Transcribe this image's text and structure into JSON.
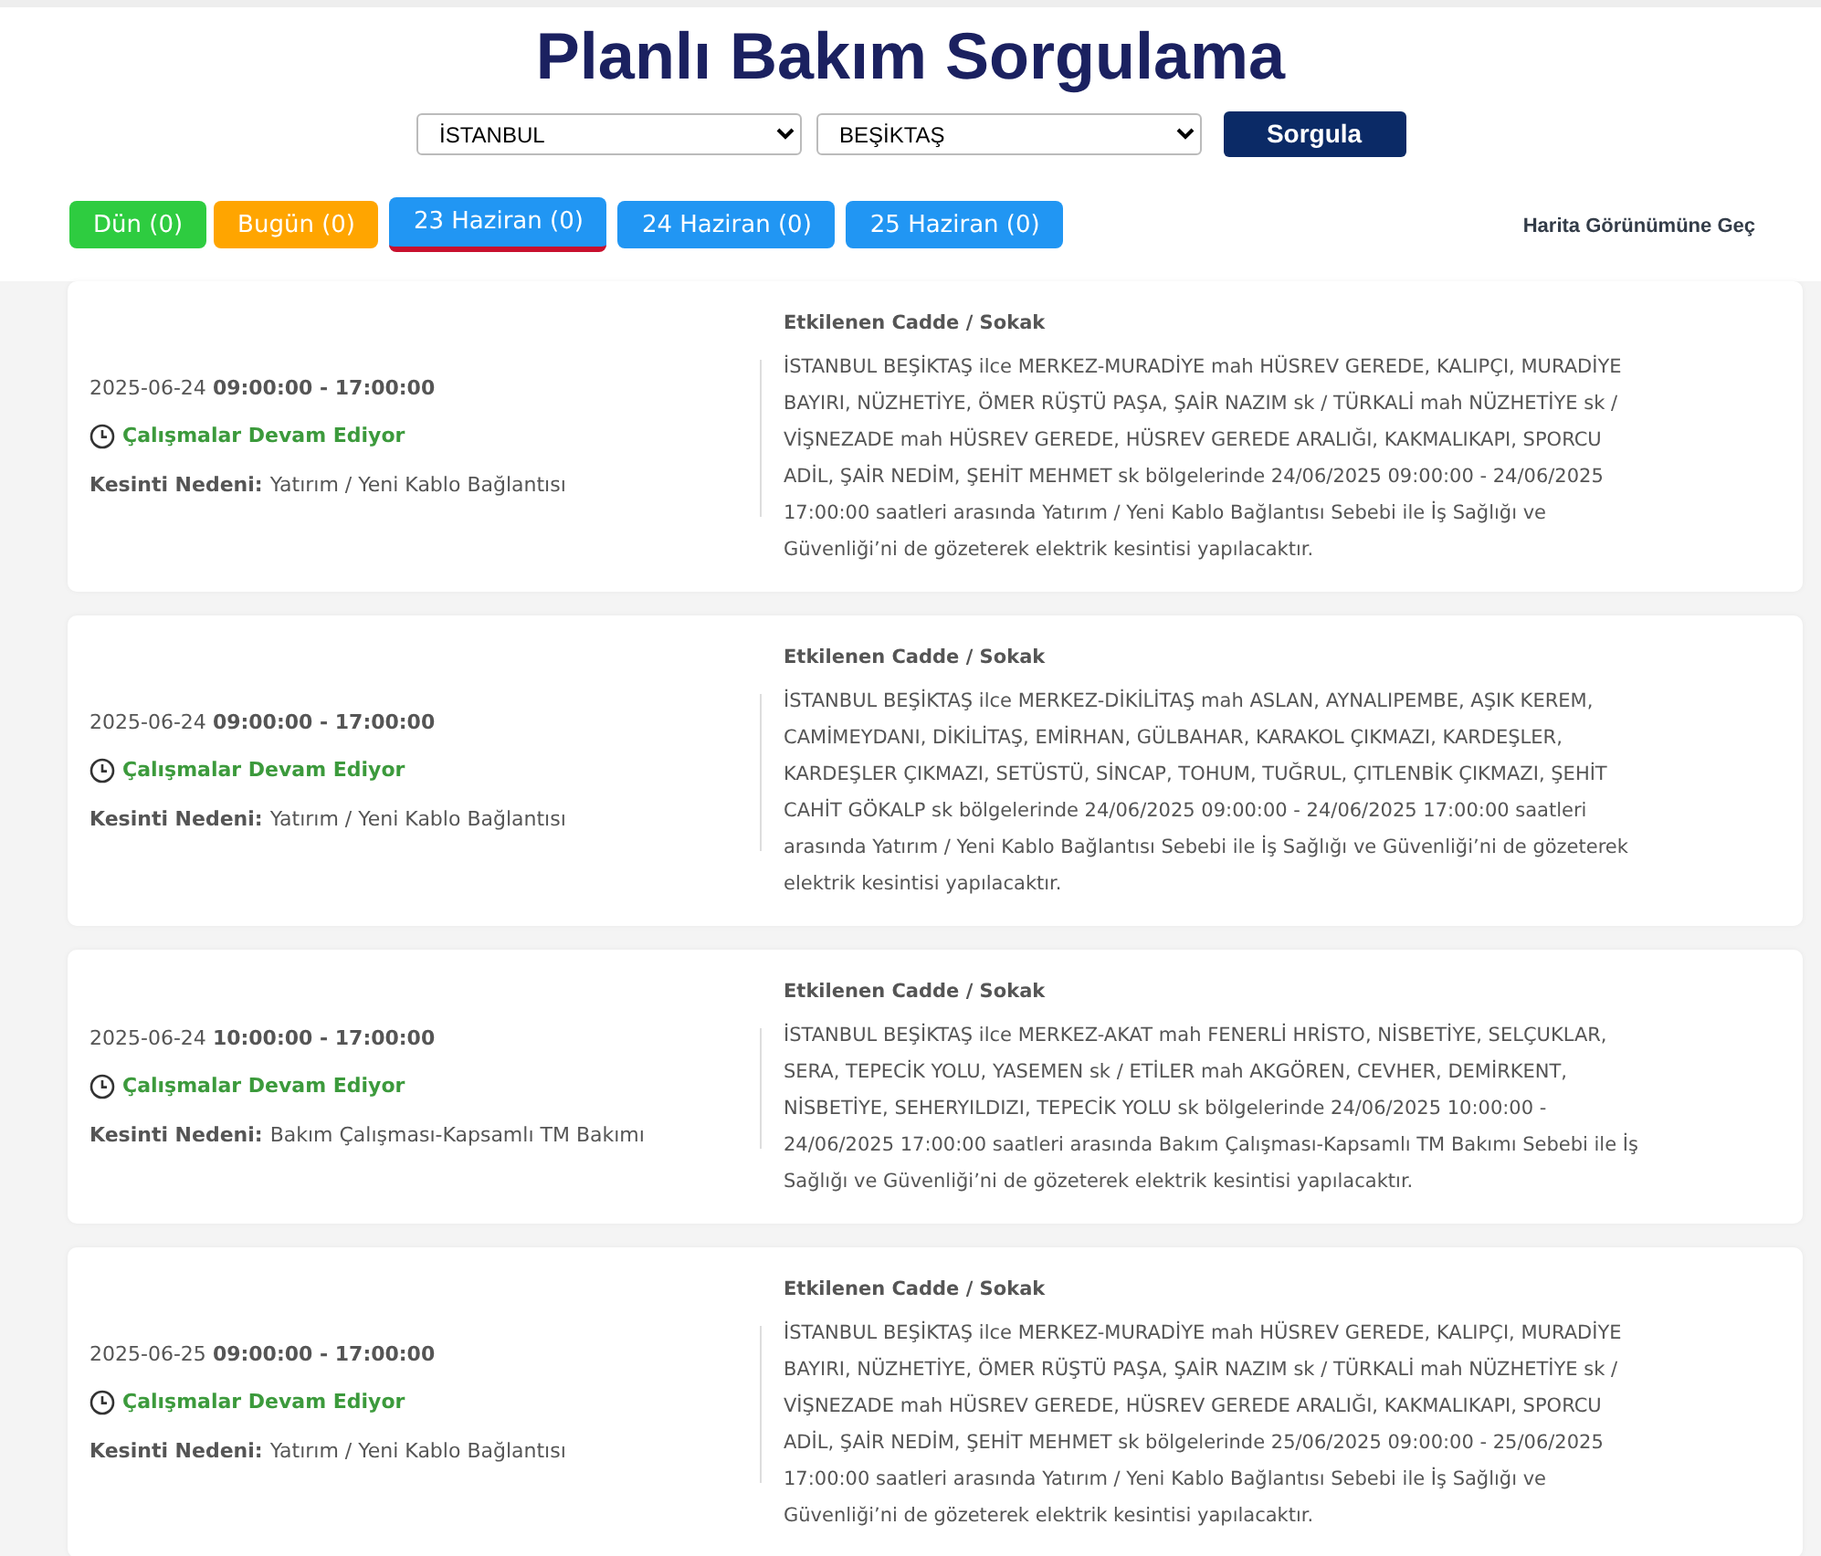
{
  "title": "Planlı Bakım Sorgulama",
  "filters": {
    "city": "İSTANBUL",
    "district": "BEŞİKTAŞ",
    "button": "Sorgula"
  },
  "tabs": [
    {
      "label": "Dün (0)",
      "color": "#2ecc40",
      "selected": false
    },
    {
      "label": "Bugün (0)",
      "color": "#ffa500",
      "selected": false
    },
    {
      "label": "23 Haziran (0)",
      "color": "#2196f3",
      "selected": true
    },
    {
      "label": "24 Haziran (0)",
      "color": "#2196f3",
      "selected": false
    },
    {
      "label": "25 Haziran (0)",
      "color": "#2196f3",
      "selected": false
    }
  ],
  "map_link": "Harita Görünümüne Geç",
  "outages": [
    {
      "date": "2025-06-24",
      "time": "09:00:00 - 17:00:00",
      "status": "Çalışmalar Devam Ediyor",
      "reason_label": "Kesinti Nedeni:",
      "reason": "Yatırım / Yeni Kablo Bağlantısı",
      "streets_label": "Etkilenen Cadde / Sokak",
      "streets": "İSTANBUL BEŞİKTAŞ ilce MERKEZ-MURADİYE mah HÜSREV GEREDE, KALIPÇI, MURADİYE BAYIRI, NÜZHETİYE, ÖMER RÜŞTÜ PAŞA, ŞAİR NAZIM sk / TÜRKALİ mah NÜZHETİYE sk / VİŞNEZADE mah HÜSREV GEREDE, HÜSREV GEREDE ARALIĞI, KAKMALIKAPI, SPORCU ADİL, ŞAİR NEDİM, ŞEHİT MEHMET sk bölgelerinde 24/06/2025 09:00:00 - 24/06/2025 17:00:00 saatleri arasında Yatırım / Yeni Kablo Bağlantısı Sebebi ile İş Sağlığı ve Güvenliği’ni de gözeterek elektrik kesintisi yapılacaktır."
    },
    {
      "date": "2025-06-24",
      "time": "09:00:00 - 17:00:00",
      "status": "Çalışmalar Devam Ediyor",
      "reason_label": "Kesinti Nedeni:",
      "reason": "Yatırım / Yeni Kablo Bağlantısı",
      "streets_label": "Etkilenen Cadde / Sokak",
      "streets": "İSTANBUL BEŞİKTAŞ ilce MERKEZ-DİKİLİTAŞ mah ASLAN, AYNALIPEMBE, AŞIK KEREM, CAMİMEYDANI, DİKİLİTAŞ, EMİRHAN, GÜLBAHAR, KARAKOL ÇIKMAZI, KARDEŞLER, KARDEŞLER ÇIKMAZI, SETÜSTÜ, SİNCAP, TOHUM, TUĞRUL, ÇITLENBİK ÇIKMAZI, ŞEHİT CAHİT GÖKALP sk bölgelerinde 24/06/2025 09:00:00 - 24/06/2025 17:00:00 saatleri arasında Yatırım / Yeni Kablo Bağlantısı Sebebi ile İş Sağlığı ve Güvenliği’ni de gözeterek elektrik kesintisi yapılacaktır."
    },
    {
      "date": "2025-06-24",
      "time": "10:00:00 - 17:00:00",
      "status": "Çalışmalar Devam Ediyor",
      "reason_label": "Kesinti Nedeni:",
      "reason": "Bakım Çalışması-Kapsamlı TM Bakımı",
      "streets_label": "Etkilenen Cadde / Sokak",
      "streets": "İSTANBUL BEŞİKTAŞ ilce MERKEZ-AKAT mah FENERLİ HRİSTO, NİSBETİYE, SELÇUKLAR, SERA, TEPECİK YOLU, YASEMEN sk / ETİLER mah AKGÖREN, CEVHER, DEMİRKENT, NİSBETİYE, SEHERYILDIZI, TEPECİK YOLU sk bölgelerinde 24/06/2025 10:00:00 - 24/06/2025 17:00:00 saatleri arasında Bakım Çalışması-Kapsamlı TM Bakımı Sebebi ile İş Sağlığı ve Güvenliği’ni de gözeterek elektrik kesintisi yapılacaktır."
    },
    {
      "date": "2025-06-25",
      "time": "09:00:00 - 17:00:00",
      "status": "Çalışmalar Devam Ediyor",
      "reason_label": "Kesinti Nedeni:",
      "reason": "Yatırım / Yeni Kablo Bağlantısı",
      "streets_label": "Etkilenen Cadde / Sokak",
      "streets": "İSTANBUL BEŞİKTAŞ ilce MERKEZ-MURADİYE mah HÜSREV GEREDE, KALIPÇI, MURADİYE BAYIRI, NÜZHETİYE, ÖMER RÜŞTÜ PAŞA, ŞAİR NAZIM sk / TÜRKALİ mah NÜZHETİYE sk / VİŞNEZADE mah HÜSREV GEREDE, HÜSREV GEREDE ARALIĞI, KAKMALIKAPI, SPORCU ADİL, ŞAİR NEDİM, ŞEHİT MEHMET sk bölgelerinde 25/06/2025 09:00:00 - 25/06/2025 17:00:00 saatleri arasında Yatırım / Yeni Kablo Bağlantısı Sebebi ile İş Sağlığı ve Güvenliği’ni de gözeterek elektrik kesintisi yapılacaktır."
    }
  ]
}
